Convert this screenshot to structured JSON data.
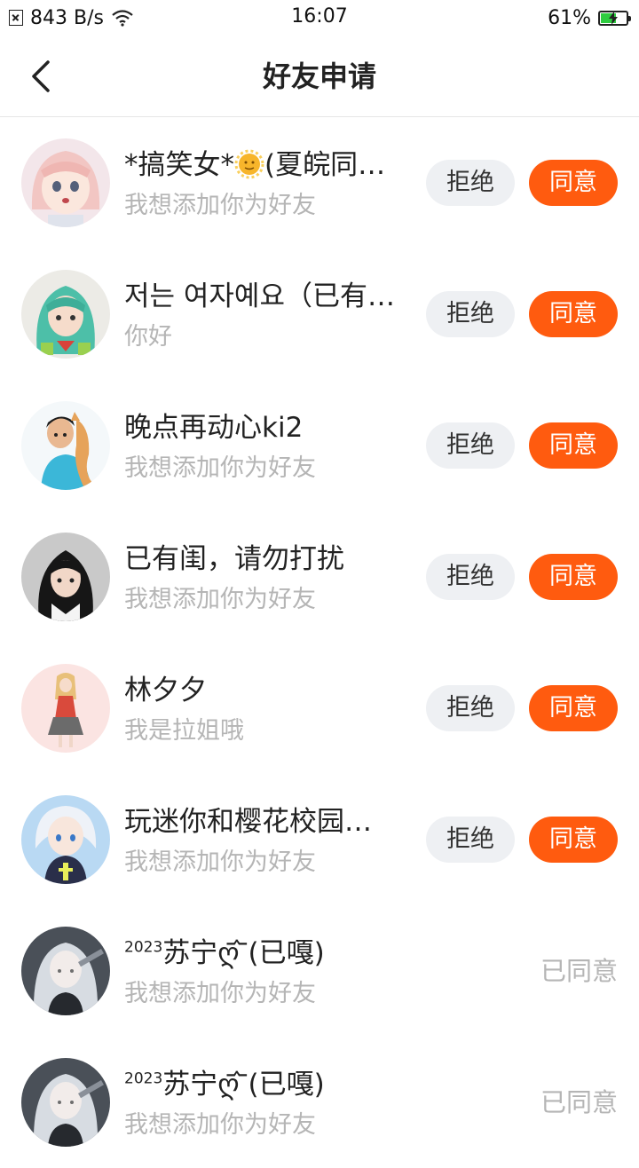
{
  "status_bar": {
    "network_speed": "843 B/s",
    "time": "16:07",
    "battery": "61%",
    "battery_level": 0.61
  },
  "nav": {
    "title": "好友申请"
  },
  "requests": [
    {
      "name_pre": "*搞笑女*",
      "name_post": "(夏皖同…",
      "message": "我想添加你为好友",
      "reject": "拒绝",
      "accept": "同意"
    },
    {
      "name": "저는 여자예요（已有…",
      "message": "你好",
      "reject": "拒绝",
      "accept": "同意"
    },
    {
      "name": "晚点再动心ki2",
      "message": "我想添加你为好友",
      "reject": "拒绝",
      "accept": "同意"
    },
    {
      "name": "已有闺，请勿打扰",
      "message": "我想添加你为好友",
      "reject": "拒绝",
      "accept": "同意"
    },
    {
      "name": "林夕夕",
      "message": "我是拉姐哦",
      "reject": "拒绝",
      "accept": "同意"
    },
    {
      "name": "玩迷你和樱花校园…",
      "message": "我想添加你为好友",
      "reject": "拒绝",
      "accept": "同意"
    },
    {
      "name_sup": "2023",
      "name": "苏宁ღ᷄ ᷅(已嘎)",
      "message": "我想添加你为好友",
      "status": "已同意"
    },
    {
      "name_sup": "2023",
      "name": "苏宁ღ᷄ ᷅(已嘎)",
      "message": "我想添加你为好友",
      "status": "已同意"
    }
  ]
}
